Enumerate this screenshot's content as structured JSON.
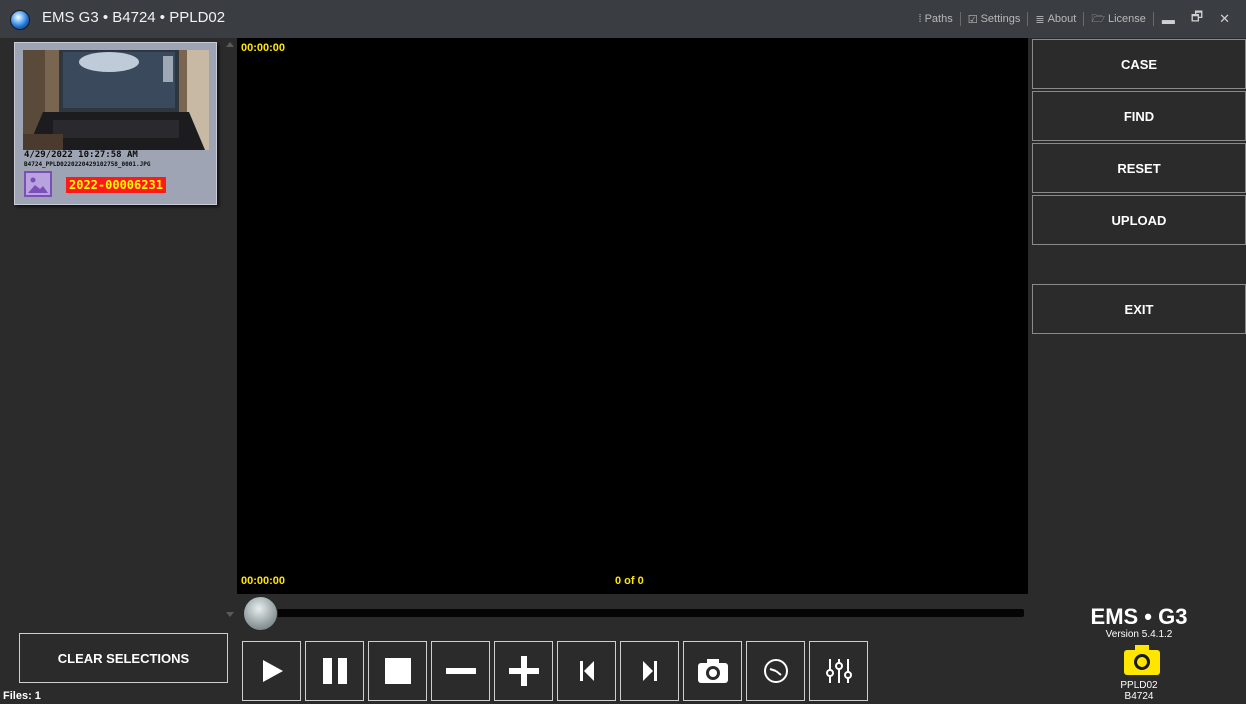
{
  "window": {
    "title": "EMS G3 • B4724 • PPLD02",
    "menu": [
      {
        "icon": "paths-icon",
        "label": "Paths"
      },
      {
        "icon": "settings-icon",
        "label": "Settings"
      },
      {
        "icon": "about-icon",
        "label": "About"
      },
      {
        "icon": "license-icon",
        "label": "License"
      }
    ],
    "controls": [
      "minimize-icon",
      "restore-icon",
      "close-icon"
    ]
  },
  "thumbnail": {
    "date": "4/29/2022 10:27:58 AM",
    "filename": "B4724_PPLD0220220429102758_0001.JPG",
    "case_number": "2022-00006231",
    "type_icon": "image-icon"
  },
  "left": {
    "clear_label": "CLEAR SELECTIONS",
    "files_label": "Files: 1"
  },
  "player": {
    "time_top": "00:00:00",
    "time_bottom": "00:00:00",
    "counter": "0 of 0",
    "position": 0
  },
  "transport": [
    {
      "name": "play-button",
      "icon": "play-icon"
    },
    {
      "name": "pause-button",
      "icon": "pause-icon"
    },
    {
      "name": "stop-button",
      "icon": "stop-icon"
    },
    {
      "name": "zoom-out-button",
      "icon": "minus-icon"
    },
    {
      "name": "zoom-in-button",
      "icon": "plus-icon"
    },
    {
      "name": "previous-button",
      "icon": "skip-back-icon"
    },
    {
      "name": "next-button",
      "icon": "skip-forward-icon"
    },
    {
      "name": "snapshot-button",
      "icon": "camera-icon"
    },
    {
      "name": "time-button",
      "icon": "clock-icon"
    },
    {
      "name": "adjust-button",
      "icon": "sliders-icon"
    }
  ],
  "actions": {
    "case": "CASE",
    "find": "FIND",
    "reset": "RESET",
    "upload": "UPLOAD",
    "exit": "EXIT"
  },
  "brand": {
    "name": "EMS • G3",
    "version": "Version 5.4.1.2",
    "station": "PPLD02",
    "badge": "B4724",
    "icon_color": "#ffe600"
  }
}
